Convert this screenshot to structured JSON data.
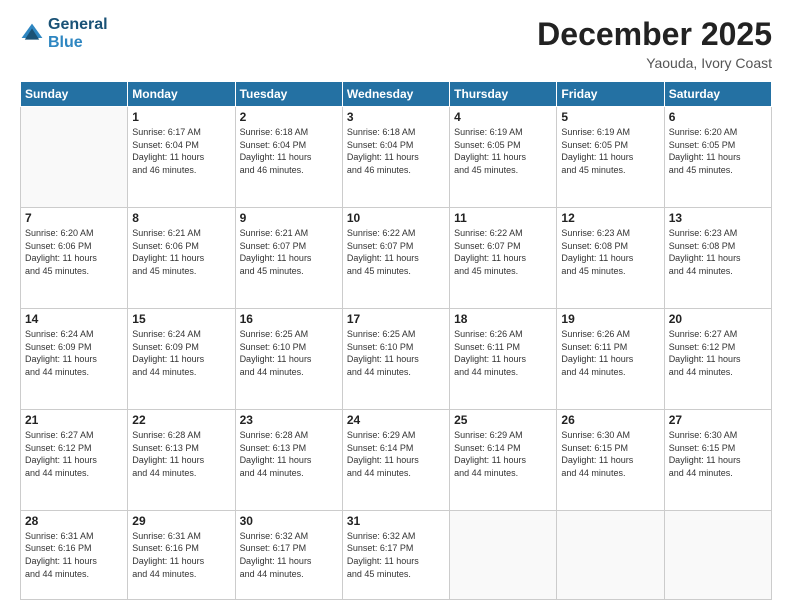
{
  "logo": {
    "line1": "General",
    "line2": "Blue"
  },
  "header": {
    "month": "December 2025",
    "location": "Yaouda, Ivory Coast"
  },
  "days_of_week": [
    "Sunday",
    "Monday",
    "Tuesday",
    "Wednesday",
    "Thursday",
    "Friday",
    "Saturday"
  ],
  "weeks": [
    [
      {
        "day": "",
        "info": ""
      },
      {
        "day": "1",
        "info": "Sunrise: 6:17 AM\nSunset: 6:04 PM\nDaylight: 11 hours\nand 46 minutes."
      },
      {
        "day": "2",
        "info": "Sunrise: 6:18 AM\nSunset: 6:04 PM\nDaylight: 11 hours\nand 46 minutes."
      },
      {
        "day": "3",
        "info": "Sunrise: 6:18 AM\nSunset: 6:04 PM\nDaylight: 11 hours\nand 46 minutes."
      },
      {
        "day": "4",
        "info": "Sunrise: 6:19 AM\nSunset: 6:05 PM\nDaylight: 11 hours\nand 45 minutes."
      },
      {
        "day": "5",
        "info": "Sunrise: 6:19 AM\nSunset: 6:05 PM\nDaylight: 11 hours\nand 45 minutes."
      },
      {
        "day": "6",
        "info": "Sunrise: 6:20 AM\nSunset: 6:05 PM\nDaylight: 11 hours\nand 45 minutes."
      }
    ],
    [
      {
        "day": "7",
        "info": "Sunrise: 6:20 AM\nSunset: 6:06 PM\nDaylight: 11 hours\nand 45 minutes."
      },
      {
        "day": "8",
        "info": "Sunrise: 6:21 AM\nSunset: 6:06 PM\nDaylight: 11 hours\nand 45 minutes."
      },
      {
        "day": "9",
        "info": "Sunrise: 6:21 AM\nSunset: 6:07 PM\nDaylight: 11 hours\nand 45 minutes."
      },
      {
        "day": "10",
        "info": "Sunrise: 6:22 AM\nSunset: 6:07 PM\nDaylight: 11 hours\nand 45 minutes."
      },
      {
        "day": "11",
        "info": "Sunrise: 6:22 AM\nSunset: 6:07 PM\nDaylight: 11 hours\nand 45 minutes."
      },
      {
        "day": "12",
        "info": "Sunrise: 6:23 AM\nSunset: 6:08 PM\nDaylight: 11 hours\nand 45 minutes."
      },
      {
        "day": "13",
        "info": "Sunrise: 6:23 AM\nSunset: 6:08 PM\nDaylight: 11 hours\nand 44 minutes."
      }
    ],
    [
      {
        "day": "14",
        "info": "Sunrise: 6:24 AM\nSunset: 6:09 PM\nDaylight: 11 hours\nand 44 minutes."
      },
      {
        "day": "15",
        "info": "Sunrise: 6:24 AM\nSunset: 6:09 PM\nDaylight: 11 hours\nand 44 minutes."
      },
      {
        "day": "16",
        "info": "Sunrise: 6:25 AM\nSunset: 6:10 PM\nDaylight: 11 hours\nand 44 minutes."
      },
      {
        "day": "17",
        "info": "Sunrise: 6:25 AM\nSunset: 6:10 PM\nDaylight: 11 hours\nand 44 minutes."
      },
      {
        "day": "18",
        "info": "Sunrise: 6:26 AM\nSunset: 6:11 PM\nDaylight: 11 hours\nand 44 minutes."
      },
      {
        "day": "19",
        "info": "Sunrise: 6:26 AM\nSunset: 6:11 PM\nDaylight: 11 hours\nand 44 minutes."
      },
      {
        "day": "20",
        "info": "Sunrise: 6:27 AM\nSunset: 6:12 PM\nDaylight: 11 hours\nand 44 minutes."
      }
    ],
    [
      {
        "day": "21",
        "info": "Sunrise: 6:27 AM\nSunset: 6:12 PM\nDaylight: 11 hours\nand 44 minutes."
      },
      {
        "day": "22",
        "info": "Sunrise: 6:28 AM\nSunset: 6:13 PM\nDaylight: 11 hours\nand 44 minutes."
      },
      {
        "day": "23",
        "info": "Sunrise: 6:28 AM\nSunset: 6:13 PM\nDaylight: 11 hours\nand 44 minutes."
      },
      {
        "day": "24",
        "info": "Sunrise: 6:29 AM\nSunset: 6:14 PM\nDaylight: 11 hours\nand 44 minutes."
      },
      {
        "day": "25",
        "info": "Sunrise: 6:29 AM\nSunset: 6:14 PM\nDaylight: 11 hours\nand 44 minutes."
      },
      {
        "day": "26",
        "info": "Sunrise: 6:30 AM\nSunset: 6:15 PM\nDaylight: 11 hours\nand 44 minutes."
      },
      {
        "day": "27",
        "info": "Sunrise: 6:30 AM\nSunset: 6:15 PM\nDaylight: 11 hours\nand 44 minutes."
      }
    ],
    [
      {
        "day": "28",
        "info": "Sunrise: 6:31 AM\nSunset: 6:16 PM\nDaylight: 11 hours\nand 44 minutes."
      },
      {
        "day": "29",
        "info": "Sunrise: 6:31 AM\nSunset: 6:16 PM\nDaylight: 11 hours\nand 44 minutes."
      },
      {
        "day": "30",
        "info": "Sunrise: 6:32 AM\nSunset: 6:17 PM\nDaylight: 11 hours\nand 44 minutes."
      },
      {
        "day": "31",
        "info": "Sunrise: 6:32 AM\nSunset: 6:17 PM\nDaylight: 11 hours\nand 45 minutes."
      },
      {
        "day": "",
        "info": ""
      },
      {
        "day": "",
        "info": ""
      },
      {
        "day": "",
        "info": ""
      }
    ]
  ]
}
